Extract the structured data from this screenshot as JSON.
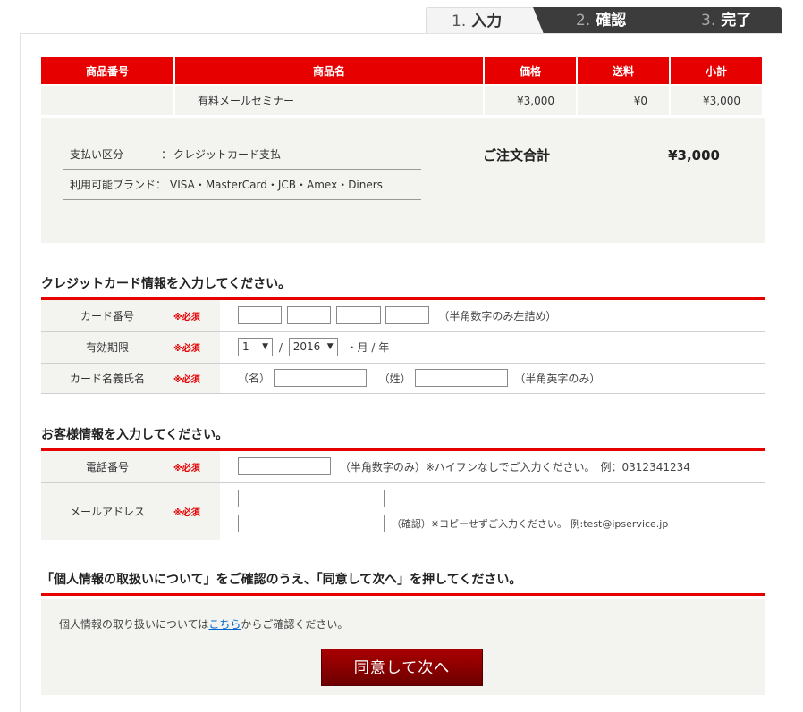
{
  "steps": [
    {
      "num": "1.",
      "label": "入力"
    },
    {
      "num": "2.",
      "label": "確認"
    },
    {
      "num": "3.",
      "label": "完了"
    }
  ],
  "product_table": {
    "headers": [
      "商品番号",
      "商品名",
      "価格",
      "送料",
      "小計"
    ],
    "row": {
      "number": "",
      "name": "有料メールセミナー",
      "price": "¥3,000",
      "shipping": "¥0",
      "subtotal": "¥3,000"
    }
  },
  "summary": {
    "payment_label": "支払い区分",
    "payment_sep": "：",
    "payment_value": "クレジットカード支払",
    "brands_label": "利用可能ブランド：",
    "brands_value": "VISA・MasterCard・JCB・Amex・Diners",
    "total_label": "ご注文合計",
    "total_value": "¥3,000"
  },
  "card_section": {
    "title": "クレジットカード情報を入力してください。",
    "required": "※必須",
    "card_number_label": "カード番号",
    "card_number_note": "（半角数字のみ左詰め）",
    "expiry_label": "有効期限",
    "expiry_month": "1",
    "expiry_year": "2016",
    "expiry_slash": "/",
    "expiry_unit": "・月 / 年",
    "name_label": "カード名義氏名",
    "first_name_label": "（名）",
    "last_name_label": "（姓）",
    "name_note": "（半角英字のみ）"
  },
  "customer_section": {
    "title": "お客様情報を入力してください。",
    "required": "※必須",
    "phone_label": "電話番号",
    "phone_note": "（半角数字のみ）※ハイフンなしでご入力ください。　例：0312341234",
    "email_label": "メールアドレス",
    "email_confirm_note": "（確認）※コピーせずご入力ください。 例:test@ipservice.jp"
  },
  "privacy": {
    "title": "「個人情報の取扱いについて」をご確認のうえ、「同意して次へ」を押してください。",
    "text_before": "個人情報の取り扱いについては",
    "link": "こちら",
    "text_after": "からご確認ください。",
    "button": "同意して次へ"
  },
  "colors": {
    "accent": "#e60000",
    "panel_bg": "#f3f3f0",
    "button": "#8b0000"
  }
}
